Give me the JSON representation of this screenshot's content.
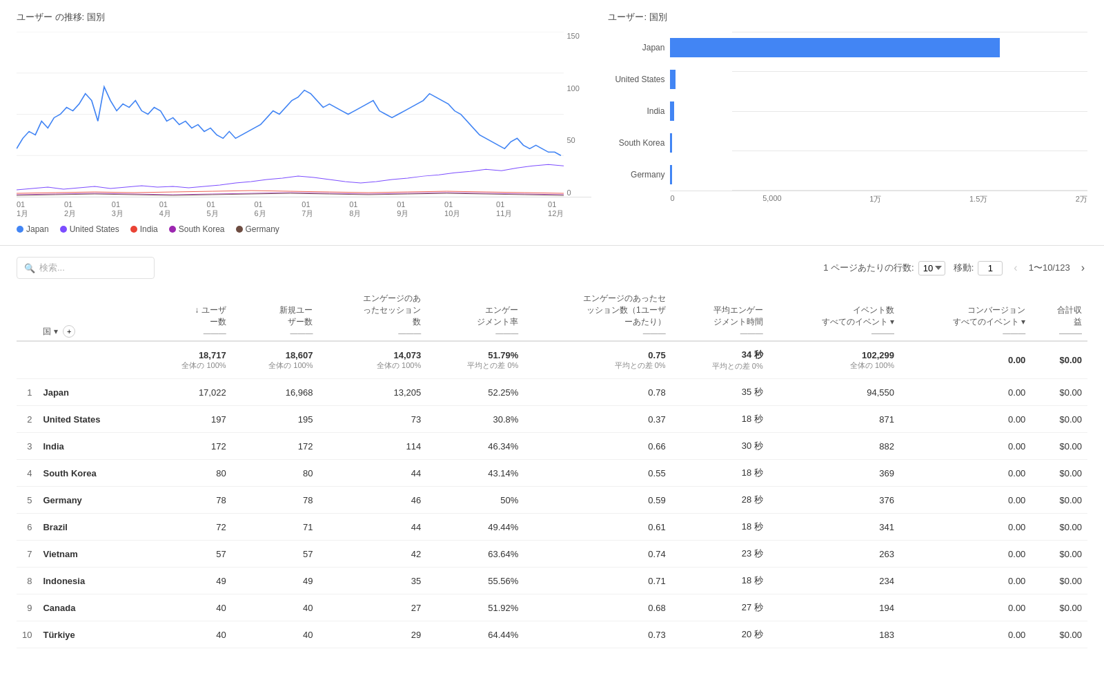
{
  "lineChart": {
    "title": "ユーザー の推移: 国別",
    "yLabels": [
      "150",
      "100",
      "50",
      "0"
    ],
    "xLabels": [
      "01\n1月",
      "01\n2月",
      "01\n3月",
      "01\n4月",
      "01\n5月",
      "01\n6月",
      "01\n7月",
      "01\n8月",
      "01\n9月",
      "01\n10月",
      "01\n11月",
      "01\n12月"
    ]
  },
  "barChart": {
    "title": "ユーザー: 国別",
    "countries": [
      "Japan",
      "United States",
      "India",
      "South Korea",
      "Germany"
    ],
    "values": [
      15800,
      197,
      172,
      80,
      78
    ],
    "maxValue": 20000,
    "xLabels": [
      "0",
      "5,000",
      "1万",
      "1.5万",
      "2万"
    ]
  },
  "legend": {
    "items": [
      {
        "label": "Japan",
        "color": "#4285f4"
      },
      {
        "label": "United States",
        "color": "#7c4dff"
      },
      {
        "label": "India",
        "color": "#ea4335"
      },
      {
        "label": "South Korea",
        "color": "#9c27b0"
      },
      {
        "label": "Germany",
        "color": "#6d4c41"
      }
    ]
  },
  "tableControls": {
    "searchPlaceholder": "検索...",
    "rowsPerPageLabel": "1 ページあたりの行数:",
    "rowsPerPageValue": "10",
    "moveToLabel": "移動:",
    "moveToValue": "1",
    "pageRange": "1〜10/123"
  },
  "tableHeaders": {
    "rank": "",
    "country": "国",
    "users": "ユーザ\nー数",
    "newUsers": "新規ユー\nザー数",
    "engagedSessions": "エンゲージのあ\nったセッション\n数",
    "engagementRate": "エンゲー\nジメント率",
    "engagedSessionsPerUser": "エンゲージのあったセ\nッション数（1ユーザ\nーあたり）",
    "avgEngagementTime": "平均エンゲー\nジメント時間",
    "eventCount": "イベント数\nすべてのイベント ▾",
    "conversions": "コンバージョン\nすべてのイベント ▾",
    "totalRevenue": "合計収\n益"
  },
  "totals": {
    "users": "18,717",
    "usersSub": "全体の 100%",
    "newUsers": "18,607",
    "newUsersSub": "全体の 100%",
    "engagedSessions": "14,073",
    "engagedSessionsSub": "全体の 100%",
    "engagementRate": "51.79%",
    "engagementRateSub": "平均との差 0%",
    "engagedPerUser": "0.75",
    "engagedPerUserSub": "平均との差 0%",
    "avgTime": "34 秒",
    "avgTimeSub": "平均との差 0%",
    "eventCount": "102,299",
    "eventCountSub": "全体の 100%",
    "conversions": "0.00",
    "totalRevenue": "$0.00"
  },
  "tableRows": [
    {
      "rank": 1,
      "country": "Japan",
      "users": "17,022",
      "newUsers": "16,968",
      "engagedSessions": "13,205",
      "engagementRate": "52.25%",
      "engagedPerUser": "0.78",
      "avgTime": "35 秒",
      "eventCount": "94,550",
      "conversions": "0.00",
      "totalRevenue": "$0.00"
    },
    {
      "rank": 2,
      "country": "United States",
      "users": "197",
      "newUsers": "195",
      "engagedSessions": "73",
      "engagementRate": "30.8%",
      "engagedPerUser": "0.37",
      "avgTime": "18 秒",
      "eventCount": "871",
      "conversions": "0.00",
      "totalRevenue": "$0.00"
    },
    {
      "rank": 3,
      "country": "India",
      "users": "172",
      "newUsers": "172",
      "engagedSessions": "114",
      "engagementRate": "46.34%",
      "engagedPerUser": "0.66",
      "avgTime": "30 秒",
      "eventCount": "882",
      "conversions": "0.00",
      "totalRevenue": "$0.00"
    },
    {
      "rank": 4,
      "country": "South Korea",
      "users": "80",
      "newUsers": "80",
      "engagedSessions": "44",
      "engagementRate": "43.14%",
      "engagedPerUser": "0.55",
      "avgTime": "18 秒",
      "eventCount": "369",
      "conversions": "0.00",
      "totalRevenue": "$0.00"
    },
    {
      "rank": 5,
      "country": "Germany",
      "users": "78",
      "newUsers": "78",
      "engagedSessions": "46",
      "engagementRate": "50%",
      "engagedPerUser": "0.59",
      "avgTime": "28 秒",
      "eventCount": "376",
      "conversions": "0.00",
      "totalRevenue": "$0.00"
    },
    {
      "rank": 6,
      "country": "Brazil",
      "users": "72",
      "newUsers": "71",
      "engagedSessions": "44",
      "engagementRate": "49.44%",
      "engagedPerUser": "0.61",
      "avgTime": "18 秒",
      "eventCount": "341",
      "conversions": "0.00",
      "totalRevenue": "$0.00"
    },
    {
      "rank": 7,
      "country": "Vietnam",
      "users": "57",
      "newUsers": "57",
      "engagedSessions": "42",
      "engagementRate": "63.64%",
      "engagedPerUser": "0.74",
      "avgTime": "23 秒",
      "eventCount": "263",
      "conversions": "0.00",
      "totalRevenue": "$0.00"
    },
    {
      "rank": 8,
      "country": "Indonesia",
      "users": "49",
      "newUsers": "49",
      "engagedSessions": "35",
      "engagementRate": "55.56%",
      "engagedPerUser": "0.71",
      "avgTime": "18 秒",
      "eventCount": "234",
      "conversions": "0.00",
      "totalRevenue": "$0.00"
    },
    {
      "rank": 9,
      "country": "Canada",
      "users": "40",
      "newUsers": "40",
      "engagedSessions": "27",
      "engagementRate": "51.92%",
      "engagedPerUser": "0.68",
      "avgTime": "27 秒",
      "eventCount": "194",
      "conversions": "0.00",
      "totalRevenue": "$0.00"
    },
    {
      "rank": 10,
      "country": "Türkiye",
      "users": "40",
      "newUsers": "40",
      "engagedSessions": "29",
      "engagementRate": "64.44%",
      "engagedPerUser": "0.73",
      "avgTime": "20 秒",
      "eventCount": "183",
      "conversions": "0.00",
      "totalRevenue": "$0.00"
    }
  ]
}
